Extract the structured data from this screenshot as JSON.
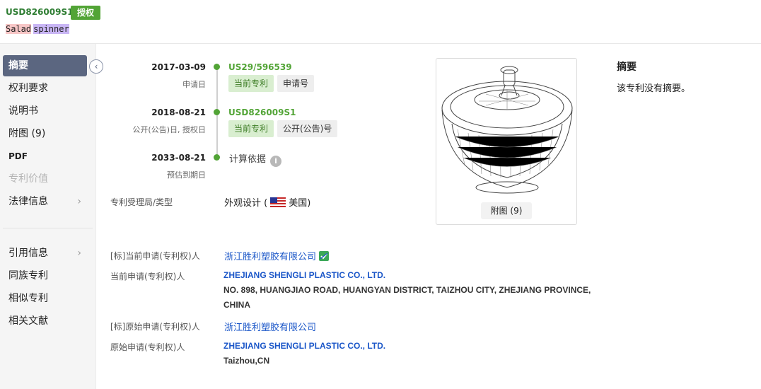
{
  "header": {
    "patent_number": "USD826009S1",
    "status_badge": "授权",
    "title_word_1": "Salad",
    "title_word_2": "spinner"
  },
  "sidebar": {
    "items": [
      {
        "label": "摘要",
        "active": true
      },
      {
        "label": "权利要求"
      },
      {
        "label": "说明书"
      },
      {
        "label": "附图 (9)"
      },
      {
        "label": "PDF"
      },
      {
        "label": "专利价值",
        "disabled": true
      },
      {
        "label": "法律信息",
        "chevron": true
      },
      {
        "label": "引用信息",
        "chevron": true
      },
      {
        "label": "同族专利"
      },
      {
        "label": "相似专利"
      },
      {
        "label": "相关文献"
      }
    ],
    "collapse_icon": "chevron-left-icon",
    "chevron_icon": "chevron-right-icon"
  },
  "timeline": {
    "events": [
      {
        "date": "2017-03-09",
        "sub": "申请日",
        "number": "US29/596539",
        "tag_current": "当前专利",
        "tag_kind": "申请号"
      },
      {
        "date": "2018-08-21",
        "sub": "公开(公告)日, 授权日",
        "number": "USD826009S1",
        "tag_current": "当前专利",
        "tag_kind": "公开(公告)号"
      },
      {
        "date": "2033-08-21",
        "sub": "预估到期日",
        "calc_label": "计算依据"
      }
    ],
    "info_icon": "info-icon"
  },
  "office": {
    "label": "专利受理局/类型",
    "type": "外观设计 (",
    "country": "美国)",
    "flag_icon": "us-flag-icon"
  },
  "figure": {
    "button": "附图 (9)"
  },
  "abstract": {
    "title": "摘要",
    "text": "该专利没有摘要。"
  },
  "applicants": {
    "std_current_label": "[标]当前申请(专利权)人",
    "std_current_value": "浙江胜利塑胶有限公司",
    "current_label": "当前申请(专利权)人",
    "current_name": "ZHEJIANG SHENGLI PLASTIC CO., LTD.",
    "current_addr_1": "NO. 898, HUANGJIAO ROAD, HUANGYAN DISTRICT, TAIZHOU CITY, ZHEJIANG PROVINCE,",
    "current_addr_2": "CHINA",
    "std_original_label": "[标]原始申请(专利权)人",
    "std_original_value": "浙江胜利塑胶有限公司",
    "original_label": "原始申请(专利权)人",
    "original_name": "ZHEJIANG SHENGLI PLASTIC CO., LTD.",
    "original_addr": "Taizhou,CN",
    "verify_icon": "verified-company-icon"
  },
  "colors": {
    "accent_green": "#52a436",
    "sidebar_active": "#5b6680",
    "link_blue": "#1a56c8"
  }
}
